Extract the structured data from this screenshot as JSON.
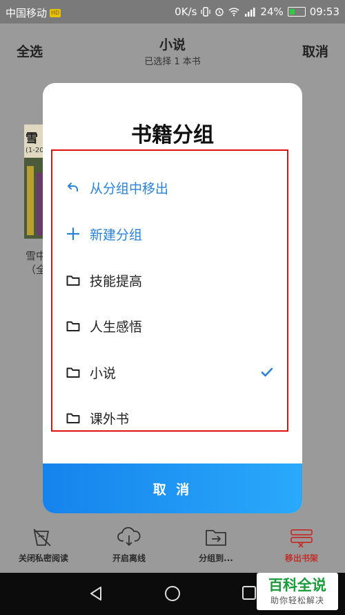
{
  "status_bar": {
    "carrier": "中国移动",
    "carrier_badge": "HD",
    "speed": "0K/s",
    "battery": "24%",
    "time": "09:53"
  },
  "header": {
    "select_all": "全选",
    "title": "小说",
    "subtitle": "已选择 1 本书",
    "cancel": "取消"
  },
  "book": {
    "cover_char": "雪",
    "cover_sub": "(1-20",
    "title_line1": "雪中",
    "title_line2": "（全"
  },
  "dialog": {
    "title": "书籍分组",
    "options": [
      {
        "label": "从分组中移出",
        "icon": "undo-arrow-icon",
        "selected": false
      },
      {
        "label": "新建分组",
        "icon": "plus-icon",
        "selected": false
      },
      {
        "label": "技能提高",
        "icon": "folder-icon",
        "selected": false
      },
      {
        "label": "人生感悟",
        "icon": "folder-icon",
        "selected": false
      },
      {
        "label": "小说",
        "icon": "folder-icon",
        "selected": true
      },
      {
        "label": "课外书",
        "icon": "folder-icon",
        "selected": false
      }
    ],
    "cancel_label": "取 消"
  },
  "bottom_bar": {
    "items": [
      {
        "label": "关闭私密阅读",
        "icon": "private-reading-icon"
      },
      {
        "label": "开启离线",
        "icon": "cloud-download-icon"
      },
      {
        "label": "分组到...",
        "icon": "move-to-folder-icon"
      },
      {
        "label": "移出书架",
        "icon": "remove-shelf-icon"
      }
    ]
  },
  "watermark": {
    "line1": "百科全说",
    "line2": "助你轻松解决"
  },
  "colors": {
    "accent": "#2a82d8",
    "highlight_border": "#e01010",
    "remove_red": "#c0302a"
  }
}
